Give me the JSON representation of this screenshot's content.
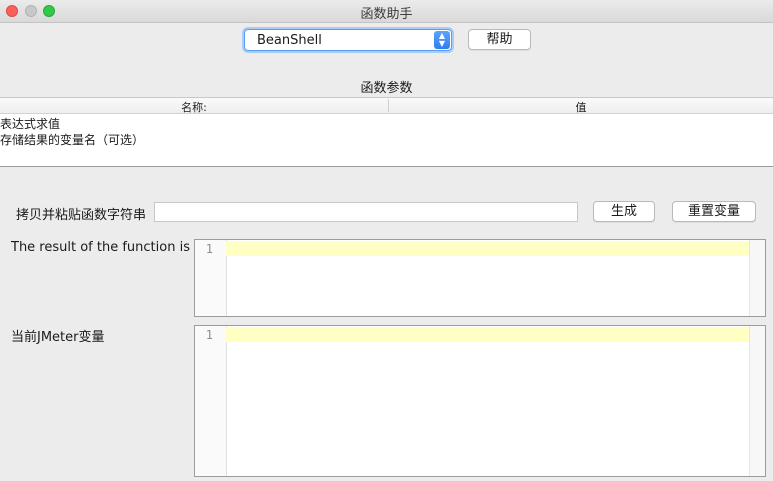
{
  "window": {
    "title": "函数助手"
  },
  "function_select": {
    "selected": "BeanShell"
  },
  "help_button": "帮助",
  "params": {
    "section_title": "函数参数",
    "columns": {
      "name": "名称:",
      "value": "值"
    },
    "rows": [
      {
        "name": "表达式求值"
      },
      {
        "name": "存储结果的变量名（可选）"
      }
    ]
  },
  "copy_paste": {
    "label": "拷贝并粘贴函数字符串",
    "value": ""
  },
  "generate_button": "生成",
  "reset_button": "重置变量",
  "result": {
    "label": "The result of the function is",
    "line_number": "1"
  },
  "jmeter_vars": {
    "label": "当前JMeter变量",
    "line_number": "1"
  }
}
